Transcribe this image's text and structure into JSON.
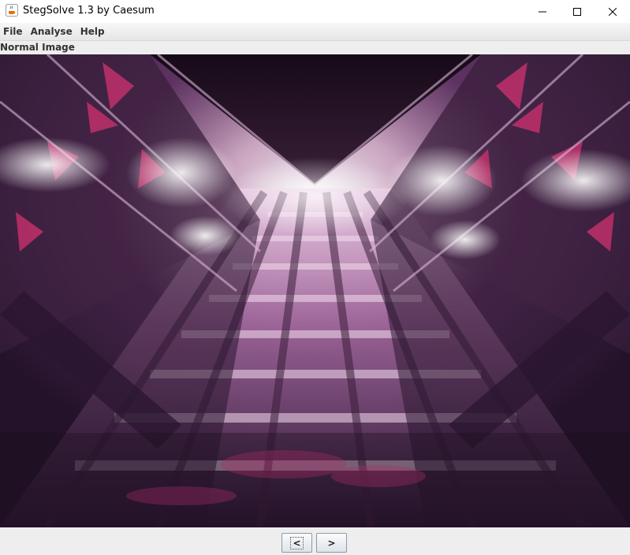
{
  "window": {
    "title": "StegSolve 1.3 by Caesum",
    "app_icon": "java-cup-icon"
  },
  "menu": {
    "items": [
      "File",
      "Analyse",
      "Help"
    ]
  },
  "view": {
    "label": "Normal Image",
    "image_description_icon": "image-canvas"
  },
  "nav": {
    "prev_label": "<",
    "next_label": ">"
  },
  "colors": {
    "accent_pink": "#c0306a",
    "image_dark": "#1a0f1e"
  }
}
